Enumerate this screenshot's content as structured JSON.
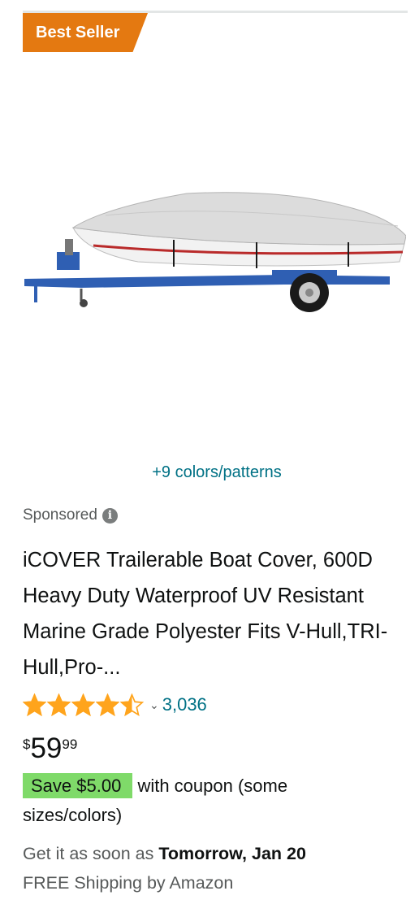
{
  "badge": {
    "label": "Best Seller"
  },
  "colors_link": "+9 colors/patterns",
  "sponsored": {
    "label": "Sponsored",
    "icon": "info-icon"
  },
  "product": {
    "title": "iCOVER Trailerable Boat Cover, 600D Heavy Duty Waterproof UV Resistant Marine Grade Polyester Fits V-Hull,TRI-Hull,Pro-...",
    "image": "boat-on-trailer-with-cover",
    "rating": 4.5,
    "rating_max": 5,
    "review_count": "3,036",
    "price": {
      "symbol": "$",
      "whole": "59",
      "fraction": "99"
    },
    "coupon": {
      "badge": "Save $5.00",
      "text": "with coupon (some sizes/colors)"
    },
    "delivery": {
      "prefix": "Get it as soon as",
      "date": "Tomorrow, Jan 20"
    },
    "shipping": "FREE Shipping by Amazon"
  },
  "colors": {
    "badge_bg": "#e47911",
    "link": "#007185",
    "star": "#ffa41c",
    "coupon_bg": "#7fda69",
    "secondary_text": "#565959"
  }
}
